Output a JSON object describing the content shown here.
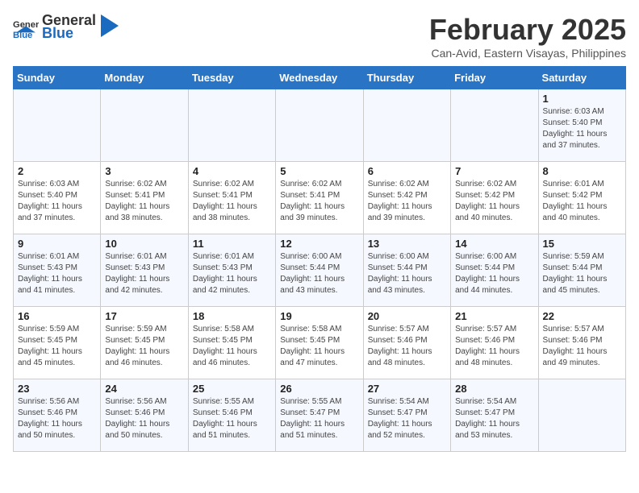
{
  "header": {
    "logo_general": "General",
    "logo_blue": "Blue",
    "month_title": "February 2025",
    "location": "Can-Avid, Eastern Visayas, Philippines"
  },
  "weekdays": [
    "Sunday",
    "Monday",
    "Tuesday",
    "Wednesday",
    "Thursday",
    "Friday",
    "Saturday"
  ],
  "weeks": [
    [
      {
        "day": "",
        "info": ""
      },
      {
        "day": "",
        "info": ""
      },
      {
        "day": "",
        "info": ""
      },
      {
        "day": "",
        "info": ""
      },
      {
        "day": "",
        "info": ""
      },
      {
        "day": "",
        "info": ""
      },
      {
        "day": "1",
        "info": "Sunrise: 6:03 AM\nSunset: 5:40 PM\nDaylight: 11 hours\nand 37 minutes."
      }
    ],
    [
      {
        "day": "2",
        "info": "Sunrise: 6:03 AM\nSunset: 5:40 PM\nDaylight: 11 hours\nand 37 minutes."
      },
      {
        "day": "3",
        "info": "Sunrise: 6:02 AM\nSunset: 5:41 PM\nDaylight: 11 hours\nand 38 minutes."
      },
      {
        "day": "4",
        "info": "Sunrise: 6:02 AM\nSunset: 5:41 PM\nDaylight: 11 hours\nand 38 minutes."
      },
      {
        "day": "5",
        "info": "Sunrise: 6:02 AM\nSunset: 5:41 PM\nDaylight: 11 hours\nand 39 minutes."
      },
      {
        "day": "6",
        "info": "Sunrise: 6:02 AM\nSunset: 5:42 PM\nDaylight: 11 hours\nand 39 minutes."
      },
      {
        "day": "7",
        "info": "Sunrise: 6:02 AM\nSunset: 5:42 PM\nDaylight: 11 hours\nand 40 minutes."
      },
      {
        "day": "8",
        "info": "Sunrise: 6:01 AM\nSunset: 5:42 PM\nDaylight: 11 hours\nand 40 minutes."
      }
    ],
    [
      {
        "day": "9",
        "info": "Sunrise: 6:01 AM\nSunset: 5:43 PM\nDaylight: 11 hours\nand 41 minutes."
      },
      {
        "day": "10",
        "info": "Sunrise: 6:01 AM\nSunset: 5:43 PM\nDaylight: 11 hours\nand 42 minutes."
      },
      {
        "day": "11",
        "info": "Sunrise: 6:01 AM\nSunset: 5:43 PM\nDaylight: 11 hours\nand 42 minutes."
      },
      {
        "day": "12",
        "info": "Sunrise: 6:00 AM\nSunset: 5:44 PM\nDaylight: 11 hours\nand 43 minutes."
      },
      {
        "day": "13",
        "info": "Sunrise: 6:00 AM\nSunset: 5:44 PM\nDaylight: 11 hours\nand 43 minutes."
      },
      {
        "day": "14",
        "info": "Sunrise: 6:00 AM\nSunset: 5:44 PM\nDaylight: 11 hours\nand 44 minutes."
      },
      {
        "day": "15",
        "info": "Sunrise: 5:59 AM\nSunset: 5:44 PM\nDaylight: 11 hours\nand 45 minutes."
      }
    ],
    [
      {
        "day": "16",
        "info": "Sunrise: 5:59 AM\nSunset: 5:45 PM\nDaylight: 11 hours\nand 45 minutes."
      },
      {
        "day": "17",
        "info": "Sunrise: 5:59 AM\nSunset: 5:45 PM\nDaylight: 11 hours\nand 46 minutes."
      },
      {
        "day": "18",
        "info": "Sunrise: 5:58 AM\nSunset: 5:45 PM\nDaylight: 11 hours\nand 46 minutes."
      },
      {
        "day": "19",
        "info": "Sunrise: 5:58 AM\nSunset: 5:45 PM\nDaylight: 11 hours\nand 47 minutes."
      },
      {
        "day": "20",
        "info": "Sunrise: 5:57 AM\nSunset: 5:46 PM\nDaylight: 11 hours\nand 48 minutes."
      },
      {
        "day": "21",
        "info": "Sunrise: 5:57 AM\nSunset: 5:46 PM\nDaylight: 11 hours\nand 48 minutes."
      },
      {
        "day": "22",
        "info": "Sunrise: 5:57 AM\nSunset: 5:46 PM\nDaylight: 11 hours\nand 49 minutes."
      }
    ],
    [
      {
        "day": "23",
        "info": "Sunrise: 5:56 AM\nSunset: 5:46 PM\nDaylight: 11 hours\nand 50 minutes."
      },
      {
        "day": "24",
        "info": "Sunrise: 5:56 AM\nSunset: 5:46 PM\nDaylight: 11 hours\nand 50 minutes."
      },
      {
        "day": "25",
        "info": "Sunrise: 5:55 AM\nSunset: 5:46 PM\nDaylight: 11 hours\nand 51 minutes."
      },
      {
        "day": "26",
        "info": "Sunrise: 5:55 AM\nSunset: 5:47 PM\nDaylight: 11 hours\nand 51 minutes."
      },
      {
        "day": "27",
        "info": "Sunrise: 5:54 AM\nSunset: 5:47 PM\nDaylight: 11 hours\nand 52 minutes."
      },
      {
        "day": "28",
        "info": "Sunrise: 5:54 AM\nSunset: 5:47 PM\nDaylight: 11 hours\nand 53 minutes."
      },
      {
        "day": "",
        "info": ""
      }
    ]
  ]
}
